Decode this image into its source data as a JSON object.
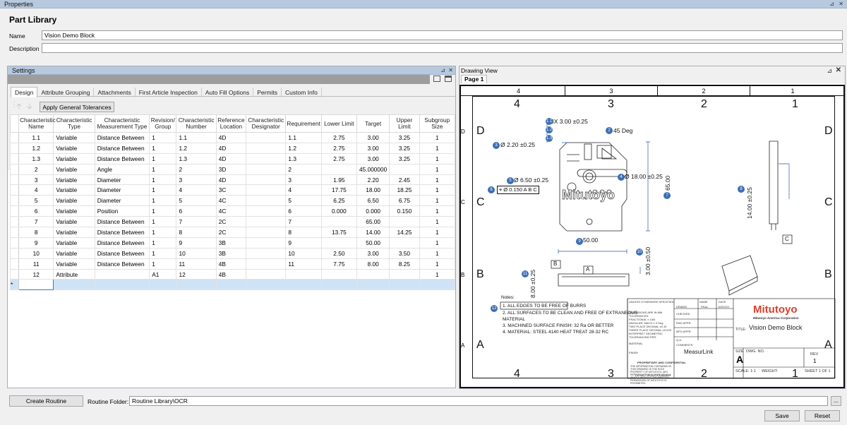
{
  "window": {
    "title": "Properties"
  },
  "header": {
    "title": "Part Library",
    "name_label": "Name",
    "name_value": "Vision Demo Block",
    "description_label": "Description",
    "description_value": ""
  },
  "settings": {
    "title": "Settings",
    "tabs": [
      "Design",
      "Attribute Grouping",
      "Attachments",
      "First Article Inspection",
      "Auto Fill Options",
      "Permits",
      "Custom Info"
    ],
    "apply_button": "Apply General Tolerances",
    "columns": [
      "Characteristic Name",
      "Characteristic Type",
      "Characteristic Measurement Type",
      "Revision/ Group",
      "Characteristic Number",
      "Reference Location",
      "Characteristic Designator",
      "Requirement",
      "Lower Limit",
      "Target",
      "Upper Limit",
      "Subgroup Size"
    ],
    "rows": [
      [
        "1.1",
        "Variable",
        "Distance Between",
        "1",
        "1.1",
        "4D",
        "",
        "1.1",
        "2.75",
        "3.00",
        "3.25",
        "1"
      ],
      [
        "1.2",
        "Variable",
        "Distance Between",
        "1",
        "1.2",
        "4D",
        "",
        "1.2",
        "2.75",
        "3.00",
        "3.25",
        "1"
      ],
      [
        "1.3",
        "Variable",
        "Distance Between",
        "1",
        "1.3",
        "4D",
        "",
        "1.3",
        "2.75",
        "3.00",
        "3.25",
        "1"
      ],
      [
        "2",
        "Variable",
        "Angle",
        "1",
        "2",
        "3D",
        "",
        "2",
        "",
        "45.000000",
        "",
        "1"
      ],
      [
        "3",
        "Variable",
        "Diameter",
        "1",
        "3",
        "4D",
        "",
        "3",
        "1.95",
        "2.20",
        "2.45",
        "1"
      ],
      [
        "4",
        "Variable",
        "Diameter",
        "1",
        "4",
        "3C",
        "",
        "4",
        "17.75",
        "18.00",
        "18.25",
        "1"
      ],
      [
        "5",
        "Variable",
        "Diameter",
        "1",
        "5",
        "4C",
        "",
        "5",
        "6.25",
        "6.50",
        "6.75",
        "1"
      ],
      [
        "6",
        "Variable",
        "Position",
        "1",
        "6",
        "4C",
        "",
        "6",
        "0.000",
        "0.000",
        "0.150",
        "1"
      ],
      [
        "7",
        "Variable",
        "Distance Between",
        "1",
        "7",
        "2C",
        "",
        "7",
        "",
        "65.00",
        "",
        "1"
      ],
      [
        "8",
        "Variable",
        "Distance Between",
        "1",
        "8",
        "2C",
        "",
        "8",
        "13.75",
        "14.00",
        "14.25",
        "1"
      ],
      [
        "9",
        "Variable",
        "Distance Between",
        "1",
        "9",
        "3B",
        "",
        "9",
        "",
        "50.00",
        "",
        "1"
      ],
      [
        "10",
        "Variable",
        "Distance Between",
        "1",
        "10",
        "3B",
        "",
        "10",
        "2.50",
        "3.00",
        "3.50",
        "1"
      ],
      [
        "11",
        "Variable",
        "Distance Between",
        "1",
        "11",
        "4B",
        "",
        "11",
        "7.75",
        "8.00",
        "8.25",
        "1"
      ],
      [
        "12",
        "Attribute",
        "",
        "A1",
        "12",
        "4B",
        "",
        "",
        "",
        "",
        "",
        "1"
      ]
    ],
    "new_row_marker": "*"
  },
  "drawing": {
    "title": "Drawing View",
    "page_tab": "Page 1",
    "ruler_cols": [
      "4",
      "3",
      "2",
      "1"
    ],
    "ruler_rows": [
      "D",
      "C",
      "B",
      "A"
    ],
    "dims": {
      "d1": "3X 3.00 ±0.25",
      "d2": "45 Deg",
      "d3": "Ø 2.20 ±0.25",
      "d4": "Ø 18.00 ±0.25",
      "d5": "Ø 6.50 ±0.25",
      "d6": "⌖ Ø 0.150 A B C",
      "d7": "65.00",
      "d8": "14.00 ±0.25",
      "d9": "50.00",
      "d10": "3.00 ±0.50",
      "d11": "8.00 ±0.25",
      "datA": "A",
      "datB": "B",
      "datC": "C"
    },
    "bubbles": [
      "1.1",
      "1.2",
      "1.3",
      "2",
      "3",
      "4",
      "5",
      "6",
      "7",
      "8",
      "9",
      "10",
      "11",
      "12"
    ],
    "notes": [
      "Notes:",
      "1. ALL EDGES TO BE FREE OF BURRS",
      "2. ALL SURFACES TO BE CLEAN AND FREE OF EXTRANEOUS",
      "MATERIAL",
      "3. MACHINED SURFACE FINISH:  32 Ra OR BETTER",
      "4. MATERIAL:  STEEL 4140 HEAT TREAT 28-32 RC"
    ],
    "logo_text": "Mitutoyo",
    "logo_sub": "Mitutoyo America Corporation",
    "part_logo": "Mitutoyo",
    "title_label": "TITLE:",
    "title_value": "Vision Demo Block",
    "size_label": "SIZE",
    "size_value": "A",
    "dwg_label": "DWG.  NO.",
    "rev_label": "REV",
    "rev_value": "1",
    "scale": "SCALE: 1:1",
    "weight": "WEIGHT:",
    "sheet": "SHEET 1 OF 1",
    "measurlink": "MeasurLink",
    "tb_unless": "UNLESS OTHERWISE SPECIFIED:",
    "tb_name": "NAME",
    "tb_date": "DATE",
    "tb_drawn": "DRAWN",
    "tb_drawn_name": "PKau",
    "tb_drawn_date": "10/01/23",
    "tb_checked": "CHECKED",
    "tb_eng": "ENG APPR.",
    "tb_mfg": "MFG APPR.",
    "tb_qa": "Q.A.",
    "tb_comments": "COMMENTS:",
    "tb_dims": "DIMENSIONS ARE IN MM",
    "tb_tol": "TOLERANCES:",
    "tb_frac": "FRACTIONAL ± 1/64",
    "tb_ang": "ANGULAR: MACH ± 0 Deg",
    "tb_two": "TWO PLACE DECIMAL    ±0.10",
    "tb_three": "THREE PLACE DECIMAL   ±0.025",
    "tb_interp": "INTERPRET GEOMETRIC",
    "tb_toler": "TOLERANCING PER:",
    "tb_material": "MATERIAL",
    "tb_finish": "FINISH",
    "tb_noscale": "DO NOT SCALE DRAWING",
    "tb_prop": "PROPRIETARY AND CONFIDENTIAL",
    "tb_prop_text": "THE INFORMATION CONTAINED IN THIS DRAWING IS THE SOLE PROPERTY OF MITUTOYO. ANY REPRODUCTION IN PART OR AS A WHOLE WITHOUT THE WRITTEN PERMISSION OF MITUTOYO IS PROHIBITED."
  },
  "footer": {
    "create_button": "Create Routine",
    "folder_label": "Routine Folder:",
    "folder_value": "Routine Library\\OCR",
    "browse": "...",
    "save": "Save",
    "reset": "Reset"
  }
}
